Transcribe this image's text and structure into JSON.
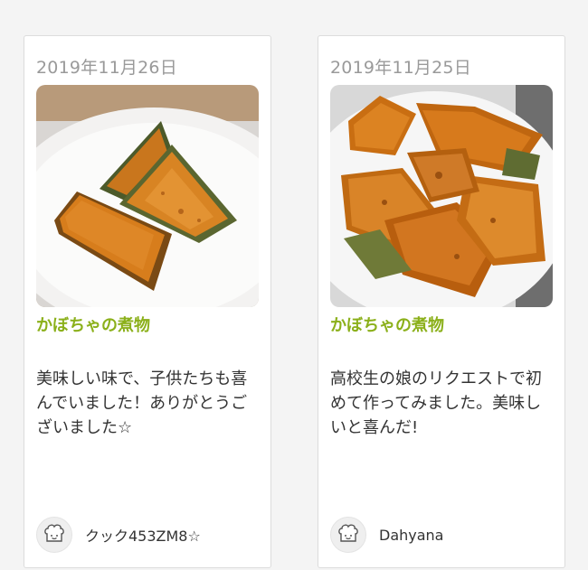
{
  "cards": [
    {
      "date": "2019年11月26日",
      "recipe_title": "かぼちゃの煮物",
      "comment": "美味しい味で、子供たちも喜んでいました！ありがとうございました☆",
      "author": "クック453ZM8☆",
      "author_icon": "chef-avatar-icon",
      "photo": "simmered pumpkin (kabocha) on white plate"
    },
    {
      "date": "2019年11月25日",
      "recipe_title": "かぼちゃの煮物",
      "comment": "高校生の娘のリクエストで初めて作ってみました。美味しいと喜んだ!",
      "author": "Dahyana",
      "author_icon": "chef-avatar-icon",
      "photo": "simmered pumpkin pieces with sauce on white plate"
    }
  ],
  "colors": {
    "title": "#8bb01a",
    "date": "#9a9a9a",
    "text": "#333333",
    "background": "#f4f4f4"
  }
}
